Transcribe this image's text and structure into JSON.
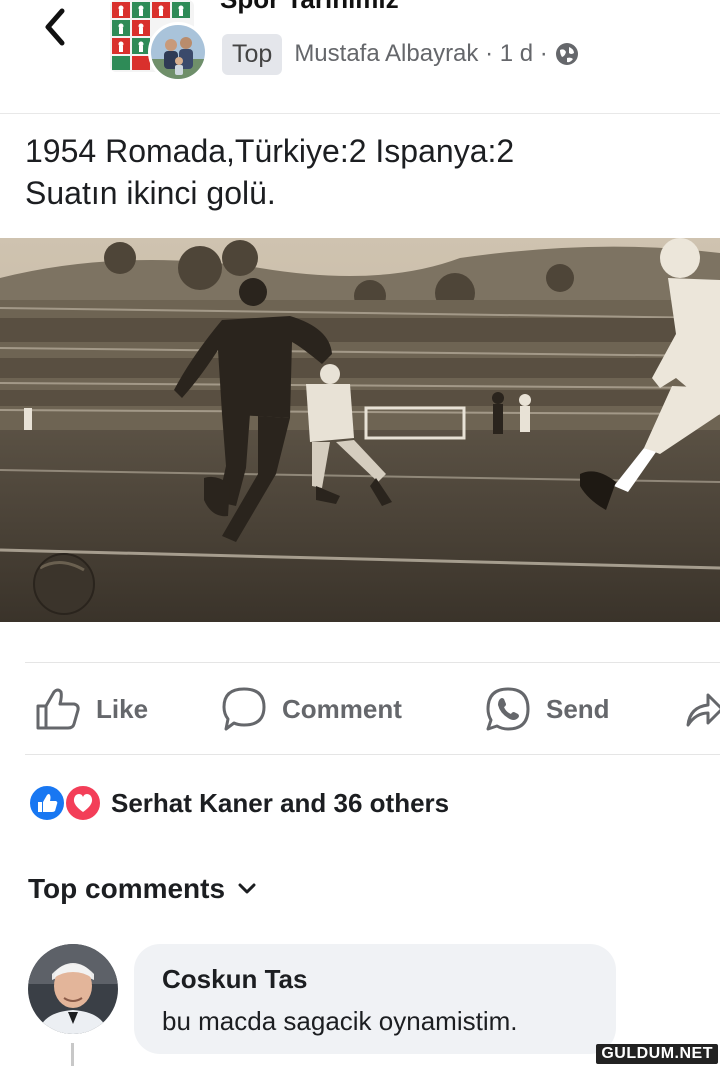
{
  "header": {
    "group_name": "Spor Tarihimiz",
    "badge": "Top",
    "author_line": "Mustafa Albayrak · 1 d ·"
  },
  "post": {
    "line1": "1954 Romada,Türkiye:2 Ispanya:2",
    "line2": "Suatın ikinci golü."
  },
  "actions": {
    "like": "Like",
    "comment": "Comment",
    "send": "Send"
  },
  "reactions": {
    "summary": "Serhat Kaner and 36 others"
  },
  "comments": {
    "section_label": "Top comments",
    "items": [
      {
        "name": "Coskun Tas",
        "text": "bu macda sagacik oynamistim."
      }
    ]
  },
  "watermark": "GULDUM.NET",
  "colors": {
    "accent_blue": "#1877f2",
    "love_red": "#f33e58",
    "muted_text": "#65676b",
    "bubble_bg": "#f0f2f5"
  }
}
